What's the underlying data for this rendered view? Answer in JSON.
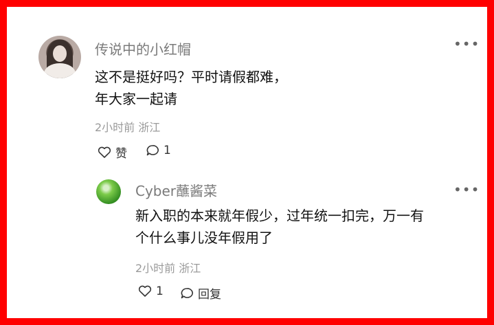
{
  "comments": [
    {
      "username": "传说中的小红帽",
      "text_line1": "这不是挺好吗？平时请假都难，",
      "text_line2": "年大家一起请",
      "time": "2小时前",
      "location": "浙江",
      "like_label": "赞",
      "reply_count": "1",
      "avatar_icon": "user-photo-avatar"
    },
    {
      "username": "Cyber蘸酱菜",
      "text_line1": "新入职的本来就年假少，过年统一扣完，万一有",
      "text_line2": "个什么事儿没年假用了",
      "time": "2小时前",
      "location": "浙江",
      "like_count": "1",
      "reply_label": "回复",
      "avatar_icon": "cabbage-avatar"
    }
  ],
  "more_icon": "more-dots-icon",
  "colors": {
    "border": "#ff0000",
    "username": "#7a7a7a",
    "text": "#111111",
    "meta": "#9a9a9a"
  }
}
